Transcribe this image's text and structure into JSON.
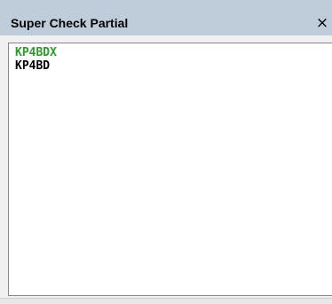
{
  "window": {
    "title": "Super Check Partial",
    "close_label": "×"
  },
  "list": {
    "items": [
      {
        "text": "KP4BDX",
        "color": "#2e9a2e"
      },
      {
        "text": "KP4BD",
        "color": "#000000"
      }
    ]
  }
}
